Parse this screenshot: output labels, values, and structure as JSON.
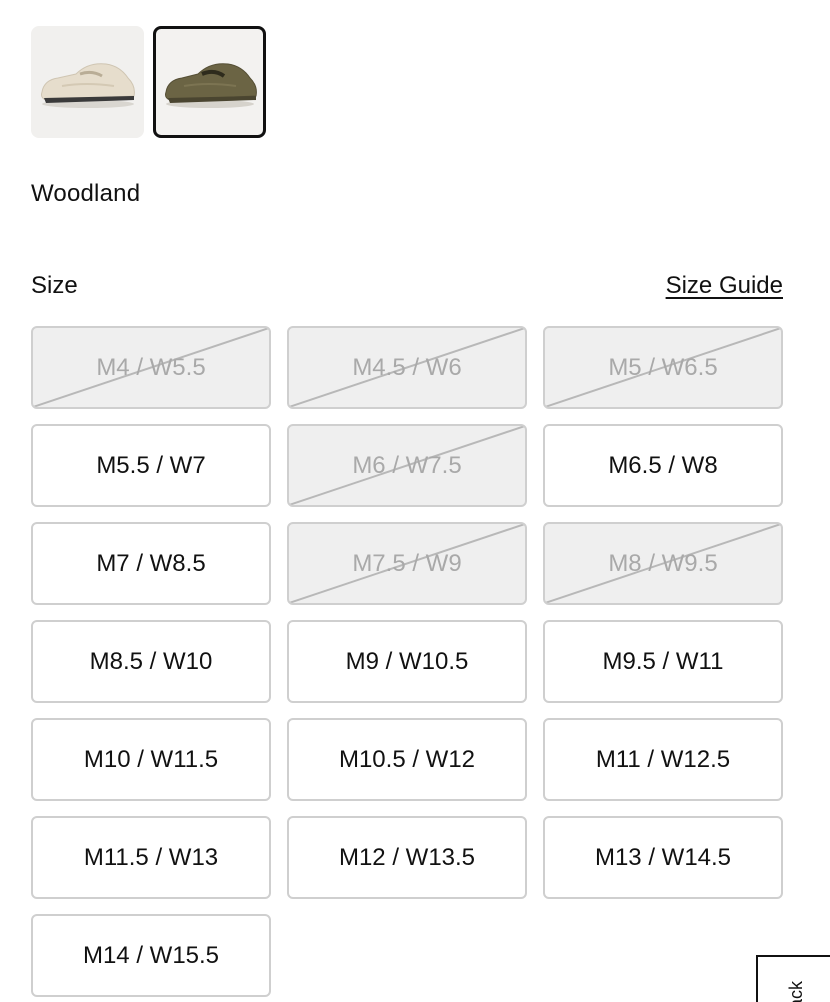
{
  "product": {
    "swatches": [
      {
        "name": "cream-loafer",
        "icon": "cream-sneaker-loafer-image",
        "selected": false
      },
      {
        "name": "woodland-loafer",
        "icon": "brown-sneaker-loafer-image",
        "selected": true
      }
    ],
    "selected_color": "Woodland"
  },
  "size_section": {
    "label": "Size",
    "guide_link": "Size Guide",
    "sizes": [
      {
        "label": "M4 / W5.5",
        "available": false
      },
      {
        "label": "M4.5 / W6",
        "available": false
      },
      {
        "label": "M5 / W6.5",
        "available": false
      },
      {
        "label": "M5.5 / W7",
        "available": true
      },
      {
        "label": "M6 / W7.5",
        "available": false
      },
      {
        "label": "M6.5 / W8",
        "available": true
      },
      {
        "label": "M7 / W8.5",
        "available": true
      },
      {
        "label": "M7.5 / W9",
        "available": false
      },
      {
        "label": "M8 / W9.5",
        "available": false
      },
      {
        "label": "M8.5 / W10",
        "available": true
      },
      {
        "label": "M9 / W10.5",
        "available": true
      },
      {
        "label": "M9.5 / W11",
        "available": true
      },
      {
        "label": "M10 / W11.5",
        "available": true
      },
      {
        "label": "M10.5 / W12",
        "available": true
      },
      {
        "label": "M11 / W12.5",
        "available": true
      },
      {
        "label": "M11.5 / W13",
        "available": true
      },
      {
        "label": "M12 / W13.5",
        "available": true
      },
      {
        "label": "M13 / W14.5",
        "available": true
      },
      {
        "label": "M14 / W15.5",
        "available": true
      }
    ]
  },
  "feedback": {
    "label": "ack"
  },
  "colors": {
    "border": "#cfcfcf",
    "unavailable_bg": "#efefef",
    "unavailable_text": "#a9a9a9",
    "text": "#111111"
  }
}
